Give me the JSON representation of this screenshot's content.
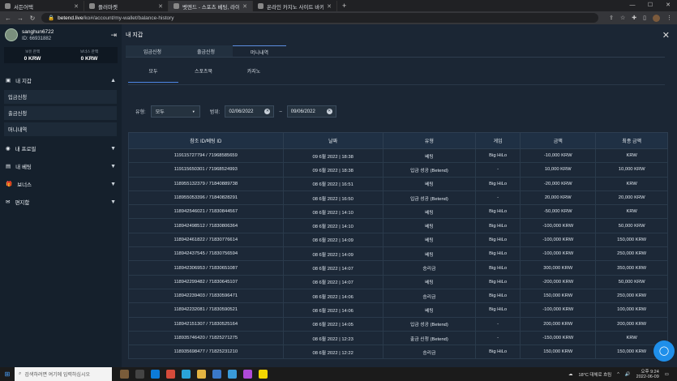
{
  "browser": {
    "tabs": [
      {
        "label": "서든어택",
        "active": false
      },
      {
        "label": "플러마켓",
        "active": false
      },
      {
        "label": "벳엔드 - 스포츠 베팅, 라이브 카",
        "active": true
      },
      {
        "label": "온라인 카지노 사이트 바카라 사",
        "active": false
      }
    ],
    "url_host": "betend.live",
    "url_path": "/ko#/account/my-wallet/balance-history"
  },
  "sidebar": {
    "username": "sanghun6722",
    "user_id": "ID: 66931882",
    "balances": [
      {
        "label": "보유 잔액",
        "value": "0 KRW"
      },
      {
        "label": "보너스 잔액",
        "value": "0 KRW"
      }
    ],
    "menu": [
      {
        "label": "내 지갑",
        "chevron": "▲"
      },
      {
        "label": "내 프로필",
        "chevron": "▼"
      },
      {
        "label": "내 베팅",
        "chevron": "▼"
      },
      {
        "label": "보너스",
        "chevron": "▼"
      },
      {
        "label": "편지함",
        "chevron": "▼"
      }
    ],
    "wallet_items": [
      "입금신청",
      "출금신청",
      "머니내역"
    ]
  },
  "main": {
    "title": "내 지갑",
    "tabs": [
      "입금신청",
      "출금신청",
      "머니내역"
    ],
    "subtabs": [
      "모두",
      "스포츠북",
      "카지노"
    ],
    "filter": {
      "type_label": "유형:",
      "type_value": "모두",
      "range_label": "범위:",
      "date_from": "02/06/2022",
      "date_to": "09/06/2022",
      "separator": "–"
    },
    "table": {
      "headers": [
        "참조 ID/베팅 ID",
        "날짜",
        "유형",
        "게임",
        "금액",
        "최종 금액"
      ],
      "rows": [
        [
          "119115727794 / 71968585659",
          "09 6월 2022 | 18:38",
          "베팅",
          "Big HiLo",
          "-10,000 KRW",
          "KRW"
        ],
        [
          "119115650301 / 71968524993",
          "09 6월 2022 | 18:38",
          "입금 성공 (Betend)",
          "-",
          "10,000 KRW",
          "10,000 KRW"
        ],
        [
          "118955132379 / 71840889738",
          "08 6월 2022 | 16:51",
          "베팅",
          "Big HiLo",
          "-20,000 KRW",
          "KRW"
        ],
        [
          "118955053396 / 71840828291",
          "08 6월 2022 | 16:50",
          "입금 성공 (Betend)",
          "-",
          "20,000 KRW",
          "20,000 KRW"
        ],
        [
          "118942546021 / 71830844567",
          "08 6월 2022 | 14:10",
          "베팅",
          "Big HiLo",
          "-50,000 KRW",
          "KRW"
        ],
        [
          "118942498512 / 71830806364",
          "08 6월 2022 | 14:10",
          "베팅",
          "Big HiLo",
          "-100,000 KRW",
          "50,000 KRW"
        ],
        [
          "118942461822 / 71830776614",
          "08 6월 2022 | 14:09",
          "베팅",
          "Big HiLo",
          "-100,000 KRW",
          "150,000 KRW"
        ],
        [
          "118942437545 / 71830756594",
          "08 6월 2022 | 14:09",
          "베팅",
          "Big HiLo",
          "-100,000 KRW",
          "250,000 KRW"
        ],
        [
          "118942306953 / 71830651087",
          "08 6월 2022 | 14:07",
          "승리금",
          "Big HiLo",
          "300,000 KRW",
          "350,000 KRW"
        ],
        [
          "118942299482 / 71830645107",
          "08 6월 2022 | 14:07",
          "베팅",
          "Big HiLo",
          "-200,000 KRW",
          "50,000 KRW"
        ],
        [
          "118942239403 / 71830596471",
          "08 6월 2022 | 14:06",
          "승리금",
          "Big HiLo",
          "150,000 KRW",
          "250,000 KRW"
        ],
        [
          "118942232081 / 71830590521",
          "08 6월 2022 | 14:06",
          "베팅",
          "Big HiLo",
          "-100,000 KRW",
          "100,000 KRW"
        ],
        [
          "118942151307 / 71830525164",
          "08 6월 2022 | 14:05",
          "입금 성공 (Betend)",
          "-",
          "200,000 KRW",
          "200,000 KRW"
        ],
        [
          "118935746420 / 71825271275",
          "08 6월 2022 | 12:23",
          "출금 신청 (Betend)",
          "-",
          "-150,000 KRW",
          "KRW"
        ],
        [
          "118935698477 / 71825231210",
          "08 6월 2022 | 12:22",
          "승리금",
          "Big HiLo",
          "150,000 KRW",
          "150,000 KRW"
        ]
      ]
    }
  },
  "taskbar": {
    "search_placeholder": "검색하려면 여기에 입력하십시오",
    "weather": "18°C 대체로 흐림",
    "time": "오후 9:24",
    "date": "2022-06-09"
  }
}
